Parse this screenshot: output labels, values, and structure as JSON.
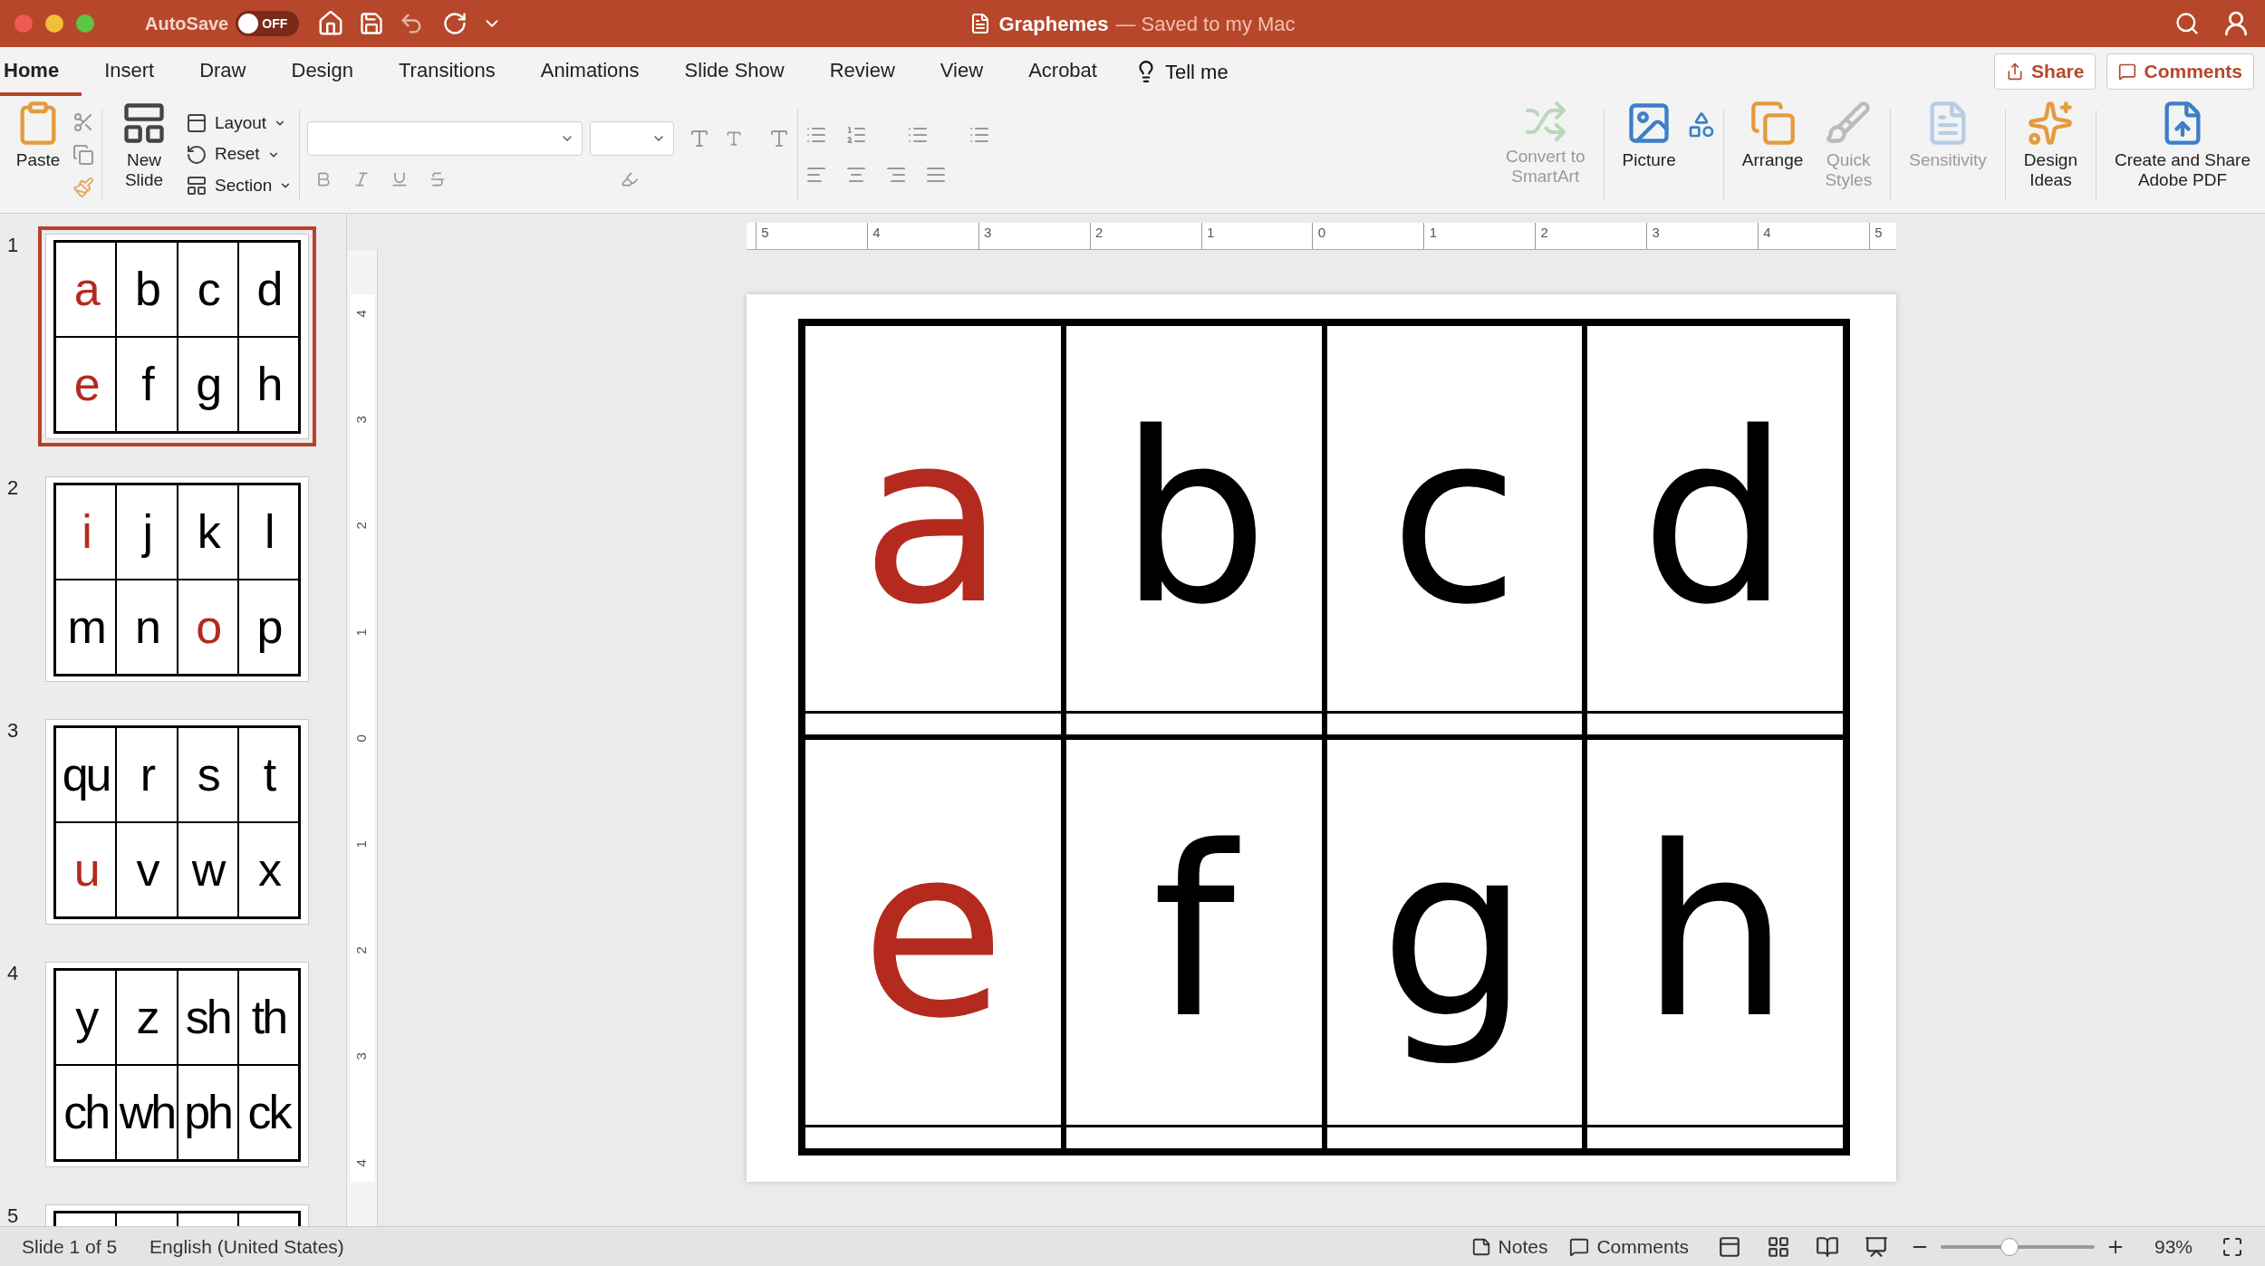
{
  "title_bar": {
    "autosave_label": "AutoSave",
    "autosave": {
      "on": false,
      "text": "OFF"
    },
    "title": "Graphemes",
    "status": "— Saved to my Mac"
  },
  "tabs": [
    {
      "label": "Home",
      "selected": true
    },
    {
      "label": "Insert",
      "selected": false
    },
    {
      "label": "Draw",
      "selected": false
    },
    {
      "label": "Design",
      "selected": false
    },
    {
      "label": "Transitions",
      "selected": false
    },
    {
      "label": "Animations",
      "selected": false
    },
    {
      "label": "Slide Show",
      "selected": false
    },
    {
      "label": "Review",
      "selected": false
    },
    {
      "label": "View",
      "selected": false
    },
    {
      "label": "Acrobat",
      "selected": false
    }
  ],
  "tell_me": "Tell me",
  "share": "Share",
  "comments_button": "Comments",
  "ribbon": {
    "paste": "Paste",
    "new_slide": "New\nSlide",
    "slide_buttons": [
      "Layout",
      "Reset",
      "Section"
    ],
    "convert_smartart": {
      "label": "Convert to\nSmartArt",
      "disabled": true
    },
    "picture": {
      "label": "Picture",
      "disabled": false
    },
    "arrange": {
      "label": "Arrange",
      "disabled": false
    },
    "quick_styles": {
      "label": "Quick\nStyles",
      "disabled": true
    },
    "sensitivity": {
      "label": "Sensitivity",
      "disabled": true
    },
    "design_ideas": {
      "label": "Design\nIdeas",
      "disabled": false
    },
    "adobe_pdf": {
      "label": "Create and Share\nAdobe PDF",
      "disabled": false
    }
  },
  "ruler": {
    "horizontal": [
      "5",
      "4",
      "3",
      "2",
      "1",
      "0",
      "1",
      "2",
      "3",
      "4",
      "5"
    ],
    "vertical": [
      "4",
      "3",
      "2",
      "1",
      "0",
      "1",
      "2",
      "3",
      "4"
    ]
  },
  "slides": [
    {
      "number": "1",
      "selected": true,
      "tiles": [
        {
          "text": "a",
          "color": "#b52a1e"
        },
        {
          "text": "b",
          "color": "#000000"
        },
        {
          "text": "c",
          "color": "#000000"
        },
        {
          "text": "d",
          "color": "#000000"
        },
        {
          "text": "e",
          "color": "#b52a1e"
        },
        {
          "text": "f",
          "color": "#000000"
        },
        {
          "text": "g",
          "color": "#000000"
        },
        {
          "text": "h",
          "color": "#000000"
        }
      ]
    },
    {
      "number": "2",
      "selected": false,
      "tiles": [
        {
          "text": "i",
          "color": "#b52a1e"
        },
        {
          "text": "j",
          "color": "#000000"
        },
        {
          "text": "k",
          "color": "#000000"
        },
        {
          "text": "l",
          "color": "#000000"
        },
        {
          "text": "m",
          "color": "#000000"
        },
        {
          "text": "n",
          "color": "#000000"
        },
        {
          "text": "o",
          "color": "#b52a1e"
        },
        {
          "text": "p",
          "color": "#000000"
        }
      ]
    },
    {
      "number": "3",
      "selected": false,
      "tiles": [
        {
          "text": "qu",
          "color": "#000000"
        },
        {
          "text": "r",
          "color": "#000000"
        },
        {
          "text": "s",
          "color": "#000000"
        },
        {
          "text": "t",
          "color": "#000000"
        },
        {
          "text": "u",
          "color": "#b52a1e"
        },
        {
          "text": "v",
          "color": "#000000"
        },
        {
          "text": "w",
          "color": "#000000"
        },
        {
          "text": "x",
          "color": "#000000"
        }
      ]
    },
    {
      "number": "4",
      "selected": false,
      "tiles": [
        {
          "text": "y",
          "color": "#000000"
        },
        {
          "text": "z",
          "color": "#000000"
        },
        {
          "text": "sh",
          "color": "#000000"
        },
        {
          "text": "th",
          "color": "#000000"
        },
        {
          "text": "ch",
          "color": "#000000"
        },
        {
          "text": "wh",
          "color": "#000000"
        },
        {
          "text": "ph",
          "color": "#000000"
        },
        {
          "text": "ck",
          "color": "#000000"
        }
      ]
    },
    {
      "number": "5",
      "selected": false
    }
  ],
  "current_slide": {
    "tiles": [
      {
        "text": "a",
        "color": "#b52a1e"
      },
      {
        "text": "b",
        "color": "#000000"
      },
      {
        "text": "c",
        "color": "#000000"
      },
      {
        "text": "d",
        "color": "#000000"
      },
      {
        "text": "e",
        "color": "#b52a1e"
      },
      {
        "text": "f",
        "color": "#000000"
      },
      {
        "text": "g",
        "color": "#000000"
      },
      {
        "text": "h",
        "color": "#000000"
      }
    ]
  },
  "status_bar": {
    "slide": "Slide 1 of 5",
    "language": "English (United States)",
    "notes": "Notes",
    "comments": "Comments",
    "zoom": {
      "level": 0.45,
      "text": "93%"
    }
  }
}
